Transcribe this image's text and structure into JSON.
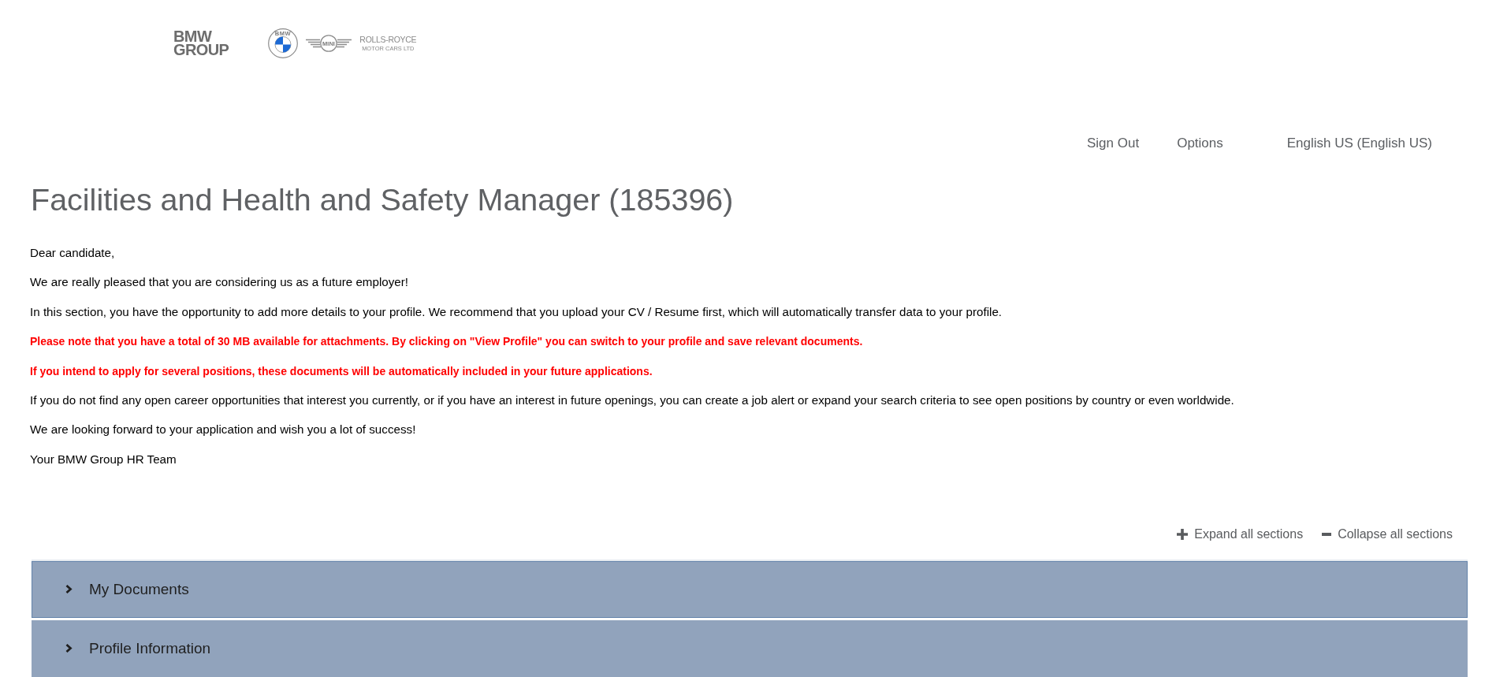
{
  "header": {
    "group_logo": [
      "BMW",
      "GROUP"
    ],
    "brand_logos": [
      {
        "kind": "roundel",
        "text": "BMW"
      },
      {
        "kind": "wings",
        "text": "MINI"
      },
      {
        "kind": "wordmark",
        "text": "ROLLS-ROYCE",
        "subtext": "MOTOR CARS LTD"
      }
    ]
  },
  "nav": {
    "links": [
      "Sign Out",
      "Options"
    ],
    "language": "English US (English US)"
  },
  "title": "Facilities and Health and Safety Manager (185396)",
  "intro": [
    {
      "text": "Dear candidate,",
      "highlighted": false
    },
    {
      "text": "We are really pleased that you are considering us as a future employer!",
      "highlighted": false
    },
    {
      "text": "In this section, you have the opportunity to add more details to your profile. We recommend that you upload your CV / Resume first, which will automatically transfer data to your profile.",
      "highlighted": false
    },
    {
      "text": "Please note that you have a total of 30 MB available for attachments. By clicking on \"View Profile\" you can switch to your profile and save relevant documents.",
      "highlighted": true
    },
    {
      "text": "If you intend to apply for several positions, these documents will be automatically included in your future applications.",
      "highlighted": true
    },
    {
      "text": "If you do not find any open career opportunities that interest you currently, or if you have an interest in future openings, you can create a job alert or expand your search criteria to see open positions by country or even worldwide.",
      "highlighted": false
    },
    {
      "text": "We are looking forward to your application and wish you a lot of success!",
      "highlighted": false
    },
    {
      "text": "Your BMW Group HR Team",
      "highlighted": false
    }
  ],
  "section_controls": [
    {
      "kind": "expand",
      "label": "Expand all sections"
    },
    {
      "kind": "collapse",
      "label": "Collapse all sections"
    }
  ],
  "sections": [
    {
      "label": "My Documents",
      "expanded": false,
      "focused": true
    },
    {
      "label": "Profile Information",
      "expanded": false,
      "focused": false
    }
  ]
}
